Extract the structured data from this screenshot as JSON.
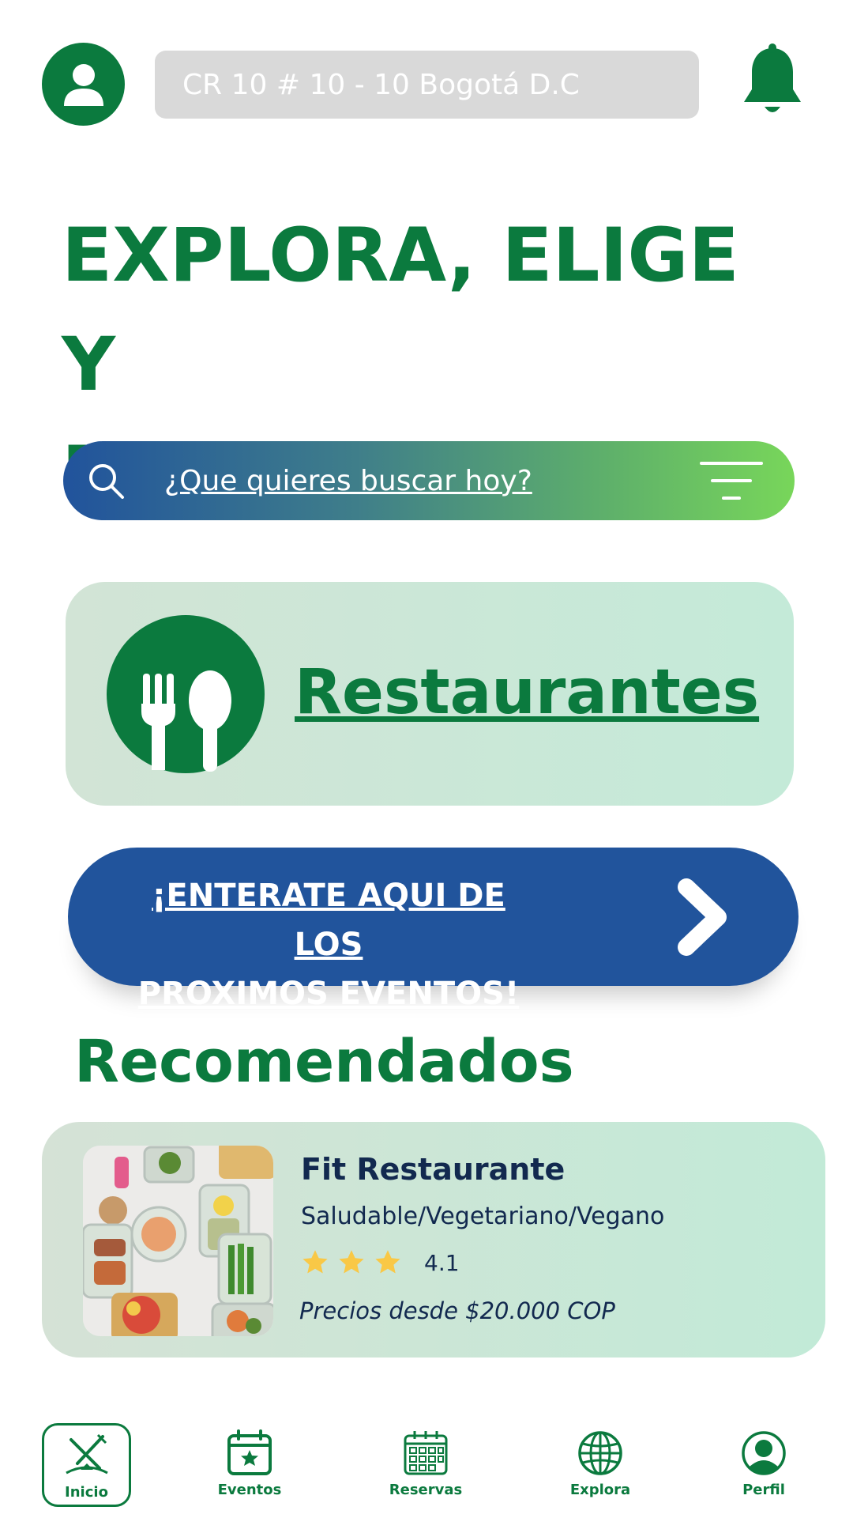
{
  "header": {
    "address": "CR 10 # 10 - 10 Bogotá D.C",
    "avatar_icon": "user-icon",
    "bell_icon": "bell-icon"
  },
  "headline": {
    "line1": "EXPLORA, ELIGE Y",
    "line2": "RESERVA"
  },
  "search": {
    "placeholder": "¿Que quieres buscar hoy?",
    "icon": "search-icon",
    "filter_icon": "filter-icon"
  },
  "category": {
    "label": "Restaurantes",
    "icon": "fork-spoon-icon"
  },
  "events_banner": {
    "line1": "¡ENTERATE AQUI DE LOS",
    "line2": "PROXIMOS EVENTOS!",
    "icon": "chevron-right-icon"
  },
  "recommended": {
    "title": "Recomendados",
    "items": [
      {
        "name": "Fit Restaurante",
        "categories": "Saludable/Vegetariano/Vegano",
        "stars": 3,
        "rating": "4.1",
        "price": "Precios desde $20.000 COP"
      }
    ]
  },
  "bottom_nav": {
    "items": [
      {
        "label": "Inicio",
        "icon": "home-dining-icon",
        "active": true
      },
      {
        "label": "Eventos",
        "icon": "calendar-star-icon",
        "active": false
      },
      {
        "label": "Reservas",
        "icon": "calendar-grid-icon",
        "active": false
      },
      {
        "label": "Explora",
        "icon": "globe-icon",
        "active": false
      },
      {
        "label": "Perfil",
        "icon": "profile-icon",
        "active": false
      }
    ]
  },
  "colors": {
    "primary_green": "#0b7a3e",
    "primary_blue": "#21549c",
    "card_bg": "#c4ead8",
    "star": "#f9c846",
    "text_dark": "#12294f"
  }
}
